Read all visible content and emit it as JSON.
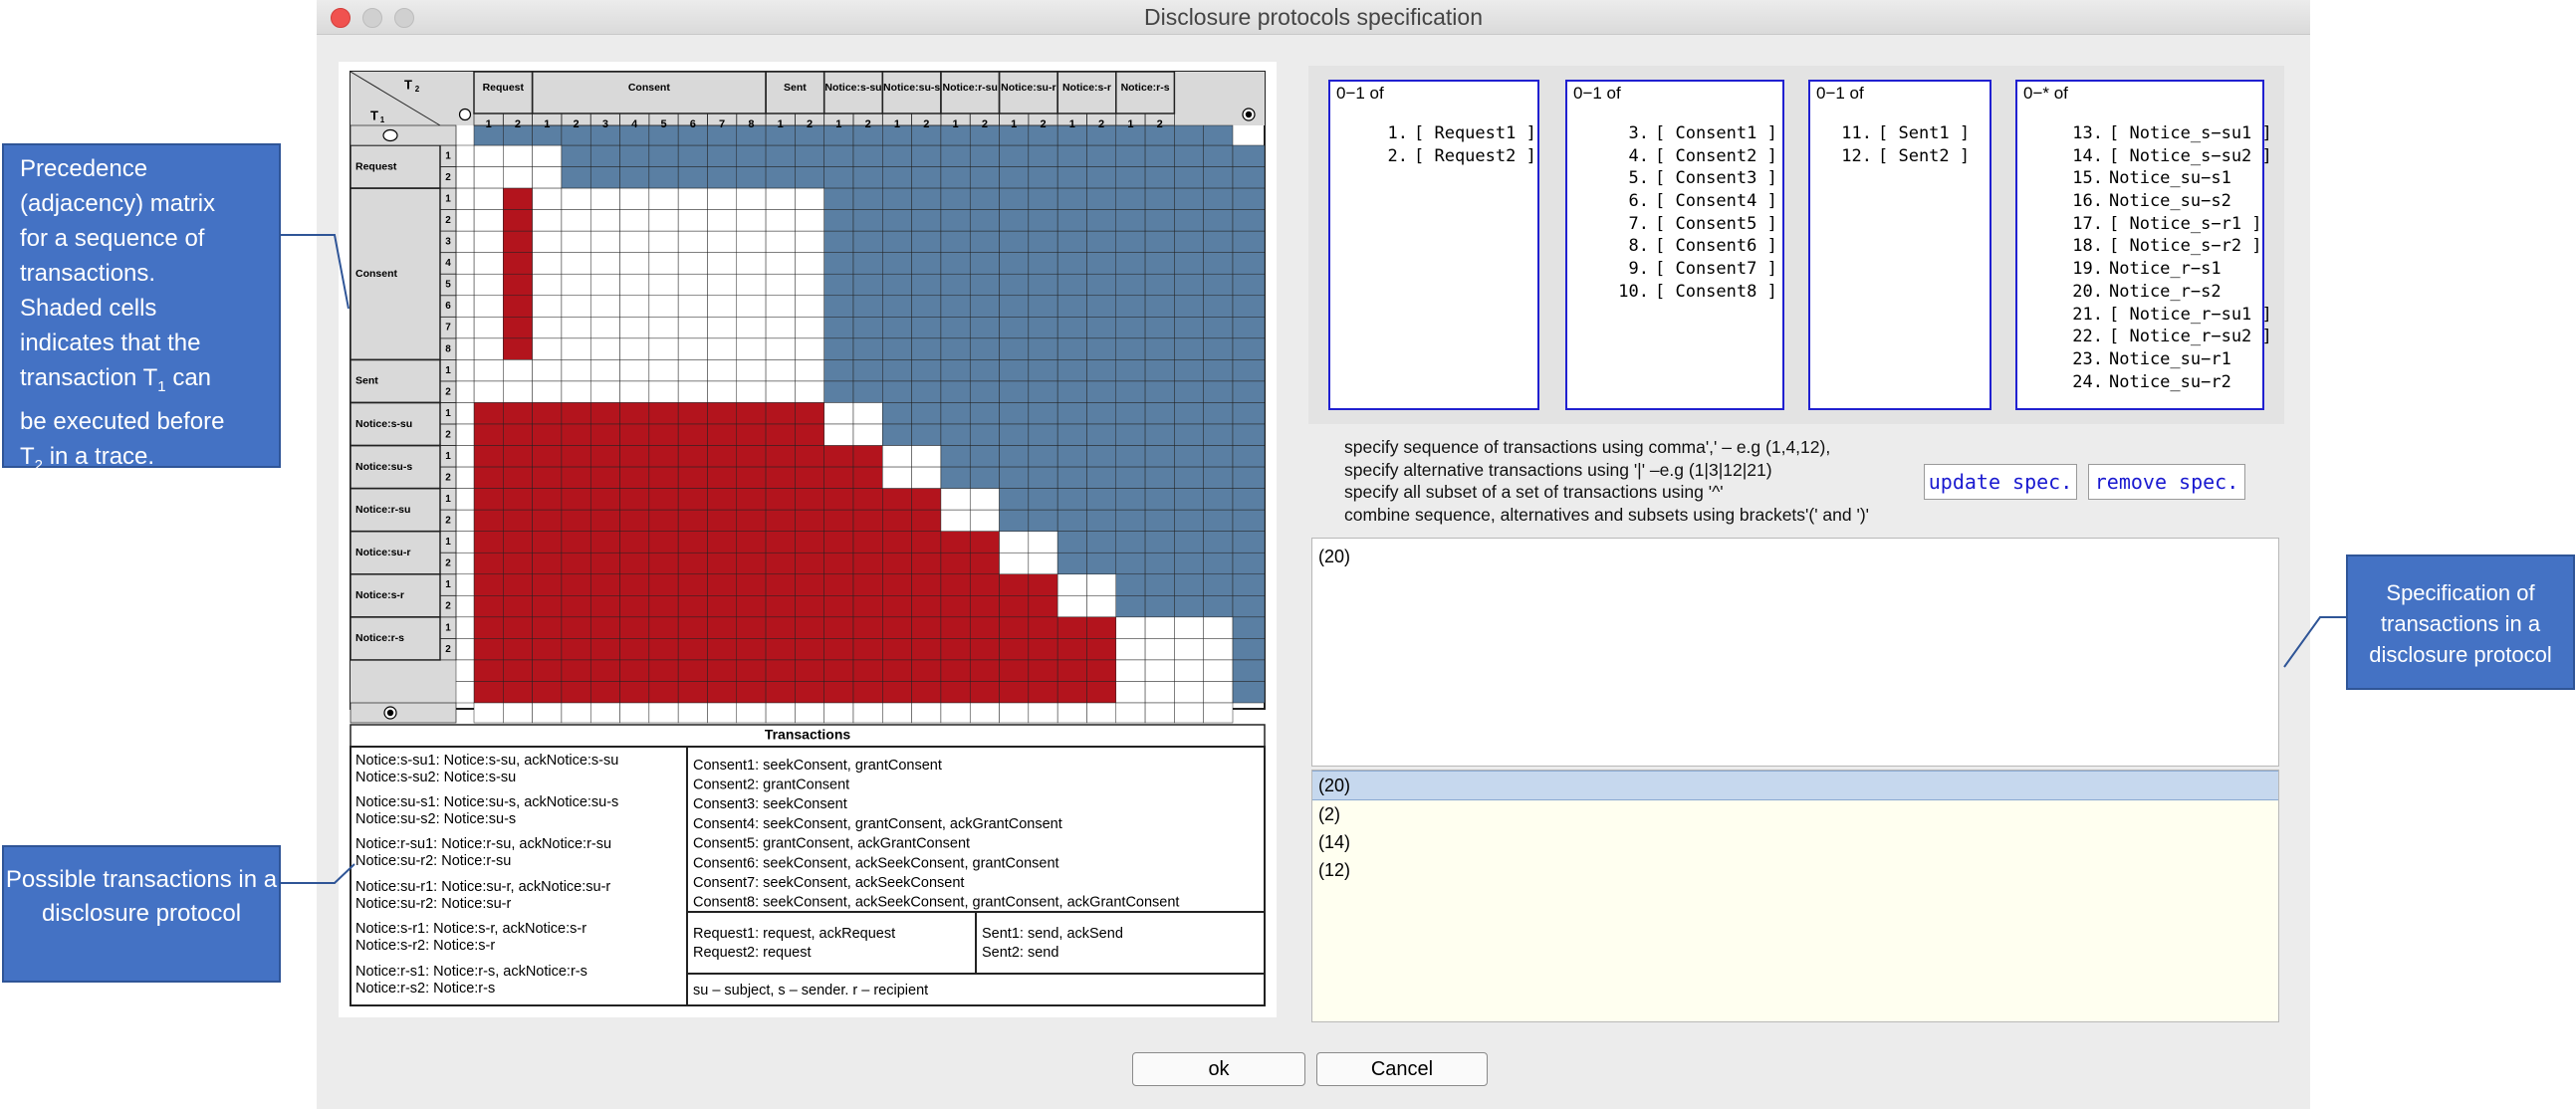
{
  "window": {
    "title": "Disclosure protocols specification"
  },
  "matrix": {
    "corner_t2": "T",
    "corner_t2_sub": "2",
    "corner_t1": "T",
    "corner_t1_sub": "1",
    "col_groups": [
      {
        "label": "Request",
        "sub": [
          "1",
          "2"
        ]
      },
      {
        "label": "Consent",
        "sub": [
          "1",
          "2",
          "3",
          "4",
          "5",
          "6",
          "7",
          "8"
        ]
      },
      {
        "label": "Sent",
        "sub": [
          "1",
          "2"
        ]
      },
      {
        "label": "Notice:s-su",
        "sub": [
          "1",
          "2"
        ]
      },
      {
        "label": "Notice:su-s",
        "sub": [
          "1",
          "2"
        ]
      },
      {
        "label": "Notice:r-su",
        "sub": [
          "1",
          "2"
        ]
      },
      {
        "label": "Notice:su-r",
        "sub": [
          "1",
          "2"
        ]
      },
      {
        "label": "Notice:s-r",
        "sub": [
          "1",
          "2"
        ]
      },
      {
        "label": "Notice:r-s",
        "sub": [
          "1",
          "2"
        ]
      }
    ],
    "row_groups": [
      {
        "label": "Request",
        "sub": [
          "1",
          "2"
        ]
      },
      {
        "label": "Consent",
        "sub": [
          "1",
          "2",
          "3",
          "4",
          "5",
          "6",
          "7",
          "8"
        ]
      },
      {
        "label": "Sent",
        "sub": [
          "1",
          "2"
        ]
      },
      {
        "label": "Notice:s-su",
        "sub": [
          "1",
          "2"
        ]
      },
      {
        "label": "Notice:su-s",
        "sub": [
          "1",
          "2"
        ]
      },
      {
        "label": "Notice:r-su",
        "sub": [
          "1",
          "2"
        ]
      },
      {
        "label": "Notice:su-r",
        "sub": [
          "1",
          "2"
        ]
      },
      {
        "label": "Notice:s-r",
        "sub": [
          "1",
          "2"
        ]
      },
      {
        "label": "Notice:r-s",
        "sub": [
          "1",
          "2"
        ]
      }
    ],
    "colors": {
      "blue": "#5a7fa3",
      "red": "#b3141d",
      "header": "#d9d9d9",
      "grid": "#222222"
    },
    "transactions_title": "Transactions",
    "notice_list": [
      "Notice:s-su1: Notice:s-su, ackNotice:s-su",
      "Notice:s-su2: Notice:s-su",
      "Notice:su-s1: Notice:su-s, ackNotice:su-s",
      "Notice:su-s2: Notice:su-s",
      "Notice:r-su1: Notice:r-su, ackNotice:r-su",
      "Notice:su-r2: Notice:r-su",
      "Notice:su-r1: Notice:su-r, ackNotice:su-r",
      "Notice:su-r2: Notice:su-r",
      "Notice:s-r1: Notice:s-r, ackNotice:s-r",
      "Notice:s-r2: Notice:s-r",
      "Notice:r-s1: Notice:r-s, ackNotice:r-s",
      "Notice:r-s2: Notice:r-s"
    ],
    "consent_list": [
      "Consent1: seekConsent,  grantConsent",
      "Consent2: grantConsent",
      "Consent3: seekConsent",
      "Consent4: seekConsent,  grantConsent, ackGrantConsent",
      "Consent5: grantConsent, ackGrantConsent",
      "Consent6: seekConsent,  ackSeekConsent,  grantConsent",
      "Consent7: seekConsent,  ackSeekConsent",
      "Consent8: seekConsent,  ackSeekConsent,  grantConsent, ackGrantConsent"
    ],
    "request_list": [
      "Request1: request, ackRequest",
      "Request2: request"
    ],
    "sent_list": [
      "Sent1: send, ackSend",
      "Sent2: send"
    ],
    "legend": "su – subject,  s – sender.    r – recipient"
  },
  "lists": [
    {
      "header": "0−1 of",
      "items": [
        {
          "num": "1.",
          "label": "[ Request1 ]"
        },
        {
          "num": "2.",
          "label": "[ Request2 ]"
        }
      ]
    },
    {
      "header": "0−1 of",
      "items": [
        {
          "num": "3.",
          "label": "[ Consent1 ]"
        },
        {
          "num": "4.",
          "label": "[ Consent2 ]"
        },
        {
          "num": "5.",
          "label": "[ Consent3 ]"
        },
        {
          "num": "6.",
          "label": "[ Consent4 ]"
        },
        {
          "num": "7.",
          "label": "[ Consent5 ]"
        },
        {
          "num": "8.",
          "label": "[ Consent6 ]"
        },
        {
          "num": "9.",
          "label": "[ Consent7 ]"
        },
        {
          "num": "10.",
          "label": "[ Consent8 ]"
        }
      ]
    },
    {
      "header": "0−1 of",
      "items": [
        {
          "num": "11.",
          "label": "[ Sent1 ]"
        },
        {
          "num": "12.",
          "label": "[ Sent2 ]"
        }
      ]
    },
    {
      "header": "0−* of",
      "items": [
        {
          "num": "13.",
          "label": "[ Notice_s−su1 ]"
        },
        {
          "num": "14.",
          "label": "[ Notice_s−su2 ]"
        },
        {
          "num": "15.",
          "label": "Notice_su−s1"
        },
        {
          "num": "16.",
          "label": "Notice_su−s2"
        },
        {
          "num": "17.",
          "label": "[ Notice_s−r1 ]"
        },
        {
          "num": "18.",
          "label": "[ Notice_s−r2 ]"
        },
        {
          "num": "19.",
          "label": "Notice_r−s1"
        },
        {
          "num": "20.",
          "label": "Notice_r−s2"
        },
        {
          "num": "21.",
          "label": "[ Notice_r−su1 ]"
        },
        {
          "num": "22.",
          "label": "[ Notice_r−su2 ]"
        },
        {
          "num": "23.",
          "label": "Notice_su−r1"
        },
        {
          "num": "24.",
          "label": "Notice_su−r2"
        }
      ]
    }
  ],
  "help_lines": [
    "specify sequence of transactions using comma',' – e.g (1,4,12),",
    "specify alternative transactions using '|' –e.g (1|3|12|21)",
    "specify all subset of a set of transactions using '^'",
    "combine sequence, alternatives and subsets using brackets'(' and ')'"
  ],
  "buttons": {
    "update": "update spec.",
    "remove": "remove spec.",
    "ok": "ok",
    "cancel": "Cancel"
  },
  "spec_text": "(20)",
  "spec_list": [
    "(20)",
    "(2)",
    "(14)",
    "(12)"
  ],
  "callouts": {
    "matrix": [
      "Precedence",
      "(adjacency)  matrix",
      "for a sequence  of",
      "transactions.",
      "Shaded cells",
      "indicates that the",
      "transaction T",
      "can",
      "be executed before",
      "T",
      "in a trace."
    ],
    "matrix_t1_sub": "1",
    "matrix_t2_sub": "2",
    "possible": "Possible transactions in a disclosure protocol",
    "spec": "Specification of transactions in a disclosure protocol"
  }
}
